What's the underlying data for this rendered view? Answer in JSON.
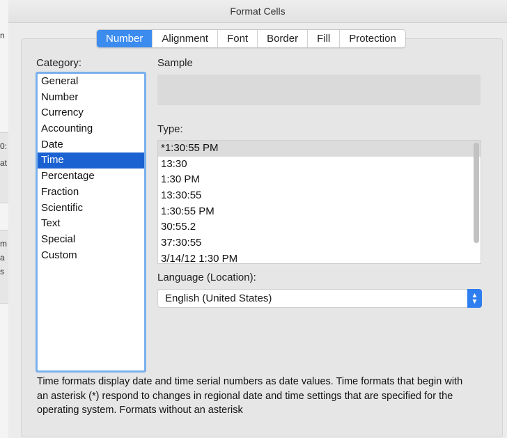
{
  "window": {
    "title": "Format Cells"
  },
  "background_fragments": [
    "n",
    "0:",
    "at",
    "m",
    "a",
    "s"
  ],
  "tabs": [
    "Number",
    "Alignment",
    "Font",
    "Border",
    "Fill",
    "Protection"
  ],
  "active_tab": "Number",
  "category": {
    "label": "Category:",
    "items": [
      "General",
      "Number",
      "Currency",
      "Accounting",
      "Date",
      "Time",
      "Percentage",
      "Fraction",
      "Scientific",
      "Text",
      "Special",
      "Custom"
    ],
    "selected": "Time"
  },
  "sample": {
    "label": "Sample",
    "value": ""
  },
  "type": {
    "label": "Type:",
    "items": [
      "*1:30:55 PM",
      "13:30",
      "1:30 PM",
      "13:30:55",
      "1:30:55 PM",
      "30:55.2",
      "37:30:55",
      "3/14/12 1:30 PM"
    ],
    "selected": "*1:30:55 PM"
  },
  "language": {
    "label": "Language (Location):",
    "value": "English (United States)"
  },
  "description": "Time formats display date and time serial numbers as date values.  Time formats that begin with an asterisk (*) respond to changes in regional date and time settings that are specified for the operating system. Formats without an asterisk",
  "colors": {
    "accent": "#3c8cf0",
    "selection": "#1a62d2",
    "focus_ring": "#7ab0ec"
  }
}
